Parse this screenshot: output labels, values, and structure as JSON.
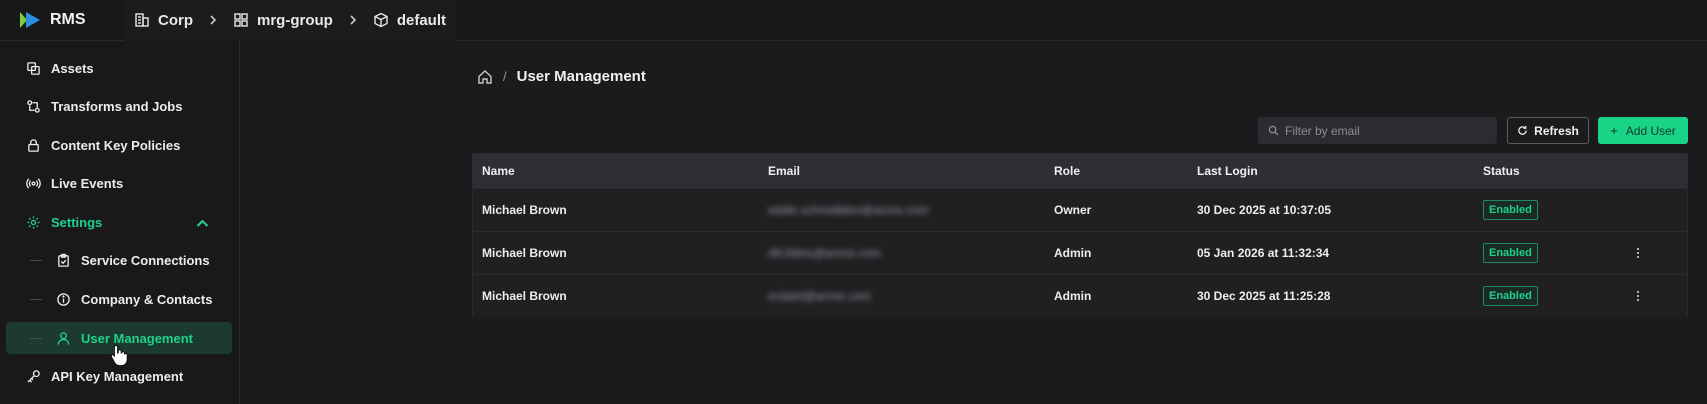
{
  "app": {
    "name": "RMS",
    "accent": "#1fd18a"
  },
  "breadcrumb": [
    {
      "label": "Corp",
      "icon": "building-icon"
    },
    {
      "label": "mrg-group",
      "icon": "grid-icon"
    },
    {
      "label": "default",
      "icon": "cube-icon"
    }
  ],
  "sidebar": {
    "items": [
      {
        "label": "Assets",
        "icon": "assets-icon"
      },
      {
        "label": "Transforms and Jobs",
        "icon": "transform-icon"
      },
      {
        "label": "Content Key Policies",
        "icon": "lock-icon"
      },
      {
        "label": "Live Events",
        "icon": "broadcast-icon"
      },
      {
        "label": "Settings",
        "icon": "gear-icon",
        "expanded": true
      },
      {
        "label": "Service Connections",
        "icon": "clipboard-icon"
      },
      {
        "label": "Company & Contacts",
        "icon": "info-icon"
      },
      {
        "label": "User Management",
        "icon": "user-icon",
        "active": true
      },
      {
        "label": "API Key Management",
        "icon": "key-icon"
      }
    ]
  },
  "page": {
    "title": "User Management",
    "filter_placeholder": "Filter by email",
    "refresh_label": "Refresh",
    "add_label": "Add User"
  },
  "table": {
    "headers": [
      "Name",
      "Email",
      "Role",
      "Last Login",
      "Status"
    ],
    "rows": [
      {
        "name": "Michael Brown",
        "email": "eddie.schmidtdev@acme.com",
        "role": "Owner",
        "last_login": "30 Dec 2025 at 10:37:05",
        "status": "Enabled",
        "menu": false
      },
      {
        "name": "Michael Brown",
        "email": "dfc3dtos@acme.com",
        "role": "Admin",
        "last_login": "05 Jan 2026 at 11:32:34",
        "status": "Enabled",
        "menu": true
      },
      {
        "name": "Michael Brown",
        "email": "eclatet@acme.com",
        "role": "Admin",
        "last_login": "30 Dec 2025 at 11:25:28",
        "status": "Enabled",
        "menu": true
      }
    ]
  }
}
